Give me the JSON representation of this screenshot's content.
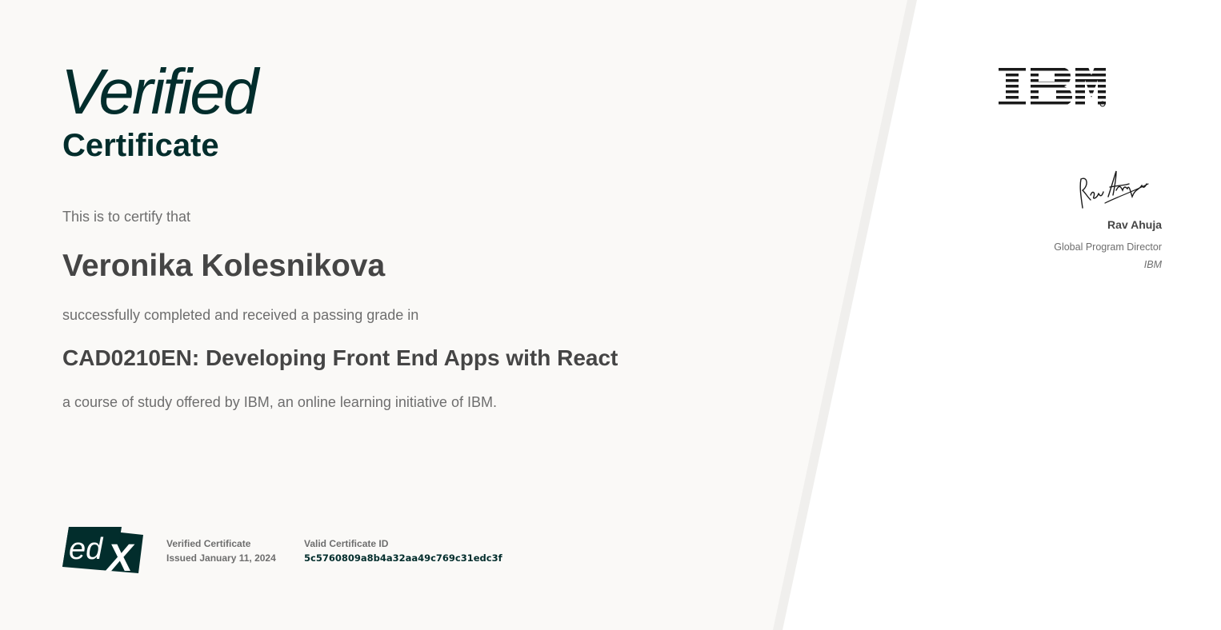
{
  "certificate": {
    "heading_main": "Verified",
    "heading_sub": "Certificate",
    "intro": "This is to certify that",
    "learner_name": "Veronika Kolesnikova",
    "completion_text": "successfully completed and received a passing grade in",
    "course_title": "CAD0210EN: Developing Front End Apps with React",
    "offered_text": "a course of study offered by IBM, an online learning initiative of IBM."
  },
  "footer": {
    "logo_text": "edX",
    "certificate_type": "Verified Certificate",
    "issued": "Issued January 11, 2024",
    "id_label": "Valid Certificate ID",
    "id_value": "5c5760809a8b4a32aa49c769c31edc3f"
  },
  "issuer": {
    "logo_text": "IBM",
    "signatory_name": "Rav Ahuja",
    "signatory_title": "Global Program Director",
    "signatory_org": "IBM"
  },
  "colors": {
    "brand_dark": "#022d2c",
    "panel_bg": "#faf9f7",
    "divider": "#f0efed",
    "text_dark": "#454545",
    "text_muted": "#6e6e6e"
  }
}
